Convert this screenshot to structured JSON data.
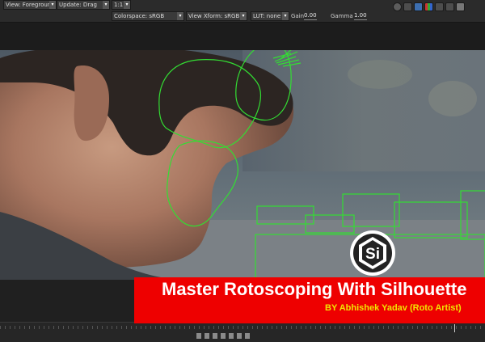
{
  "toolbar": {
    "view_dropdown": "View: Foreground",
    "update_dropdown": "Update: Drag",
    "zoom_dropdown": "1:1",
    "colorspace_dropdown": "Colorspace: sRGB",
    "view_xform_dropdown": "View Xform: sRGB",
    "lut_dropdown": "LUT: none",
    "gain_label": "Gain",
    "gain_value": "0.00",
    "gamma_label": "Gamma",
    "gamma_value": "1.00",
    "icons": [
      "circle-toggle-icon",
      "monitor-icon",
      "color-swatch-icon",
      "rgb-channel-icon",
      "crop-icon",
      "grid-icon",
      "alpha-icon"
    ]
  },
  "banner": {
    "title": "Master Rotoscoping With Silhouette",
    "subtitle": "BY Abhishek Yadav (Roto Artist)",
    "logo_text": "Si",
    "background_color": "#ee0000",
    "subtitle_color": "#f1e400"
  },
  "roto": {
    "shape_color": "#33dd33"
  },
  "timeline": {
    "transport_icons": [
      "go-to-start-icon",
      "step-back-icon",
      "play-backward-icon",
      "stop-icon",
      "play-forward-icon",
      "step-forward-icon",
      "go-to-end-icon"
    ]
  }
}
